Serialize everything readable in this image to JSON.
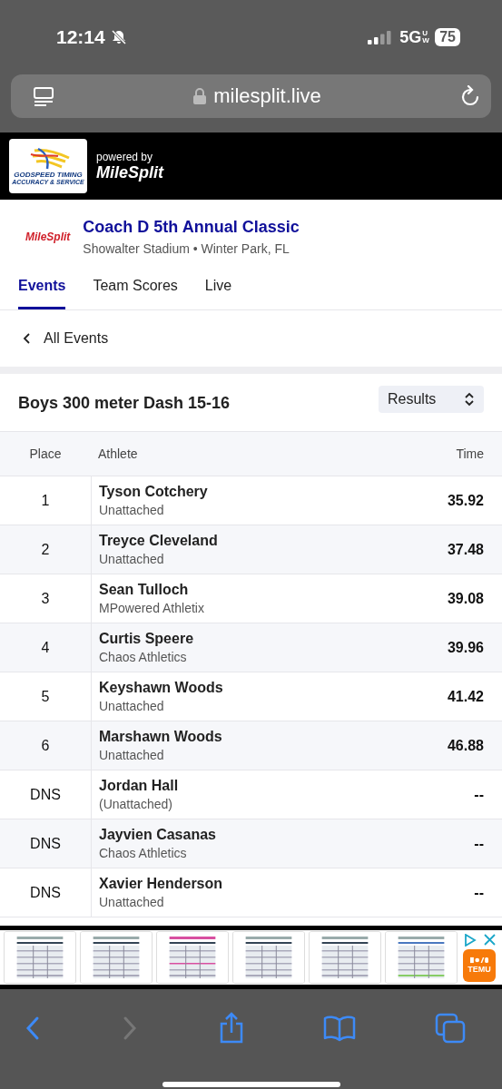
{
  "status_bar": {
    "time": "12:14",
    "network": "5G",
    "network_sub": "UW",
    "battery": "75"
  },
  "address_bar": {
    "url": "milesplit.live"
  },
  "banner": {
    "sponsor_line1": "GODSPEED TIMING",
    "sponsor_line2": "ACCURACY & SERVICE",
    "powered_by": "powered by",
    "brand": "MileSplit"
  },
  "meet": {
    "logo": "MileSplit",
    "title": "Coach D 5th Annual Classic",
    "subtitle": "Showalter Stadium • Winter Park, FL"
  },
  "tabs": [
    {
      "label": "Events",
      "selected": true
    },
    {
      "label": "Team Scores",
      "selected": false
    },
    {
      "label": "Live",
      "selected": false
    }
  ],
  "back_link": "All Events",
  "event": {
    "title": "Boys 300 meter Dash 15-16",
    "view_select": "Results"
  },
  "table": {
    "columns": [
      "Place",
      "Athlete",
      "Time"
    ],
    "rows": [
      {
        "place": "1",
        "athlete": "Tyson Cotchery",
        "team": "Unattached",
        "time": "35.92"
      },
      {
        "place": "2",
        "athlete": "Treyce Cleveland",
        "team": "Unattached",
        "time": "37.48"
      },
      {
        "place": "3",
        "athlete": "Sean Tulloch",
        "team": "MPowered Athletix",
        "time": "39.08"
      },
      {
        "place": "4",
        "athlete": "Curtis Speere",
        "team": "Chaos Athletics",
        "time": "39.96"
      },
      {
        "place": "5",
        "athlete": "Keyshawn Woods",
        "team": "Unattached",
        "time": "41.42"
      },
      {
        "place": "6",
        "athlete": "Marshawn Woods",
        "team": "Unattached",
        "time": "46.88"
      },
      {
        "place": "DNS",
        "athlete": "Jordan Hall",
        "team": "(Unattached)",
        "time": "--"
      },
      {
        "place": "DNS",
        "athlete": "Jayvien Casanas",
        "team": "Chaos Athletics",
        "time": "--"
      },
      {
        "place": "DNS",
        "athlete": "Xavier Henderson",
        "team": "Unattached",
        "time": "--"
      }
    ]
  },
  "ad": {
    "brand": "TEMU"
  }
}
